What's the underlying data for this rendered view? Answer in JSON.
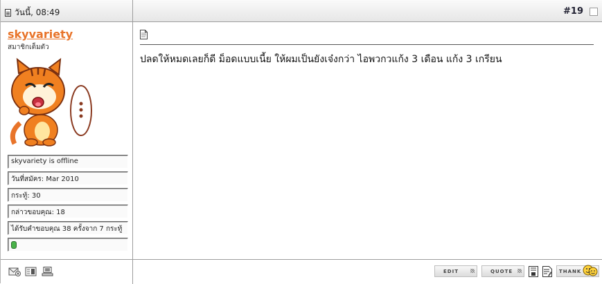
{
  "header": {
    "date_label": "วันนี้, 08:49",
    "post_number": "#19"
  },
  "user": {
    "username": "skyvariety",
    "title": "สมาชิกเต็มตัว",
    "info": [
      "skyvariety is offline",
      "วันที่สมัคร: Mar 2010",
      "กระทู้: 30",
      "กล่าวขอบคุณ: 18",
      "ได้รับคำขอบคุณ 38 ครั้งจาก 7 กระทู้"
    ],
    "online_status_color": "#48b248"
  },
  "post": {
    "message": "ปลดให้หมดเลยก็ดี ม็อดแบบเนี้ย ให้ผมเป็นยังเจ๋งกว่า ไอพวกวแก้ง 3 เดือน แก้ง 3 เกรียน"
  },
  "footer": {
    "left_icons": [
      "report-icon",
      "profile-card-icon",
      "ip-computer-icon"
    ],
    "edit_label": "EDIT",
    "quote_label": "QUOTE",
    "thank_label": "THANK",
    "accent": "#e8742a"
  }
}
